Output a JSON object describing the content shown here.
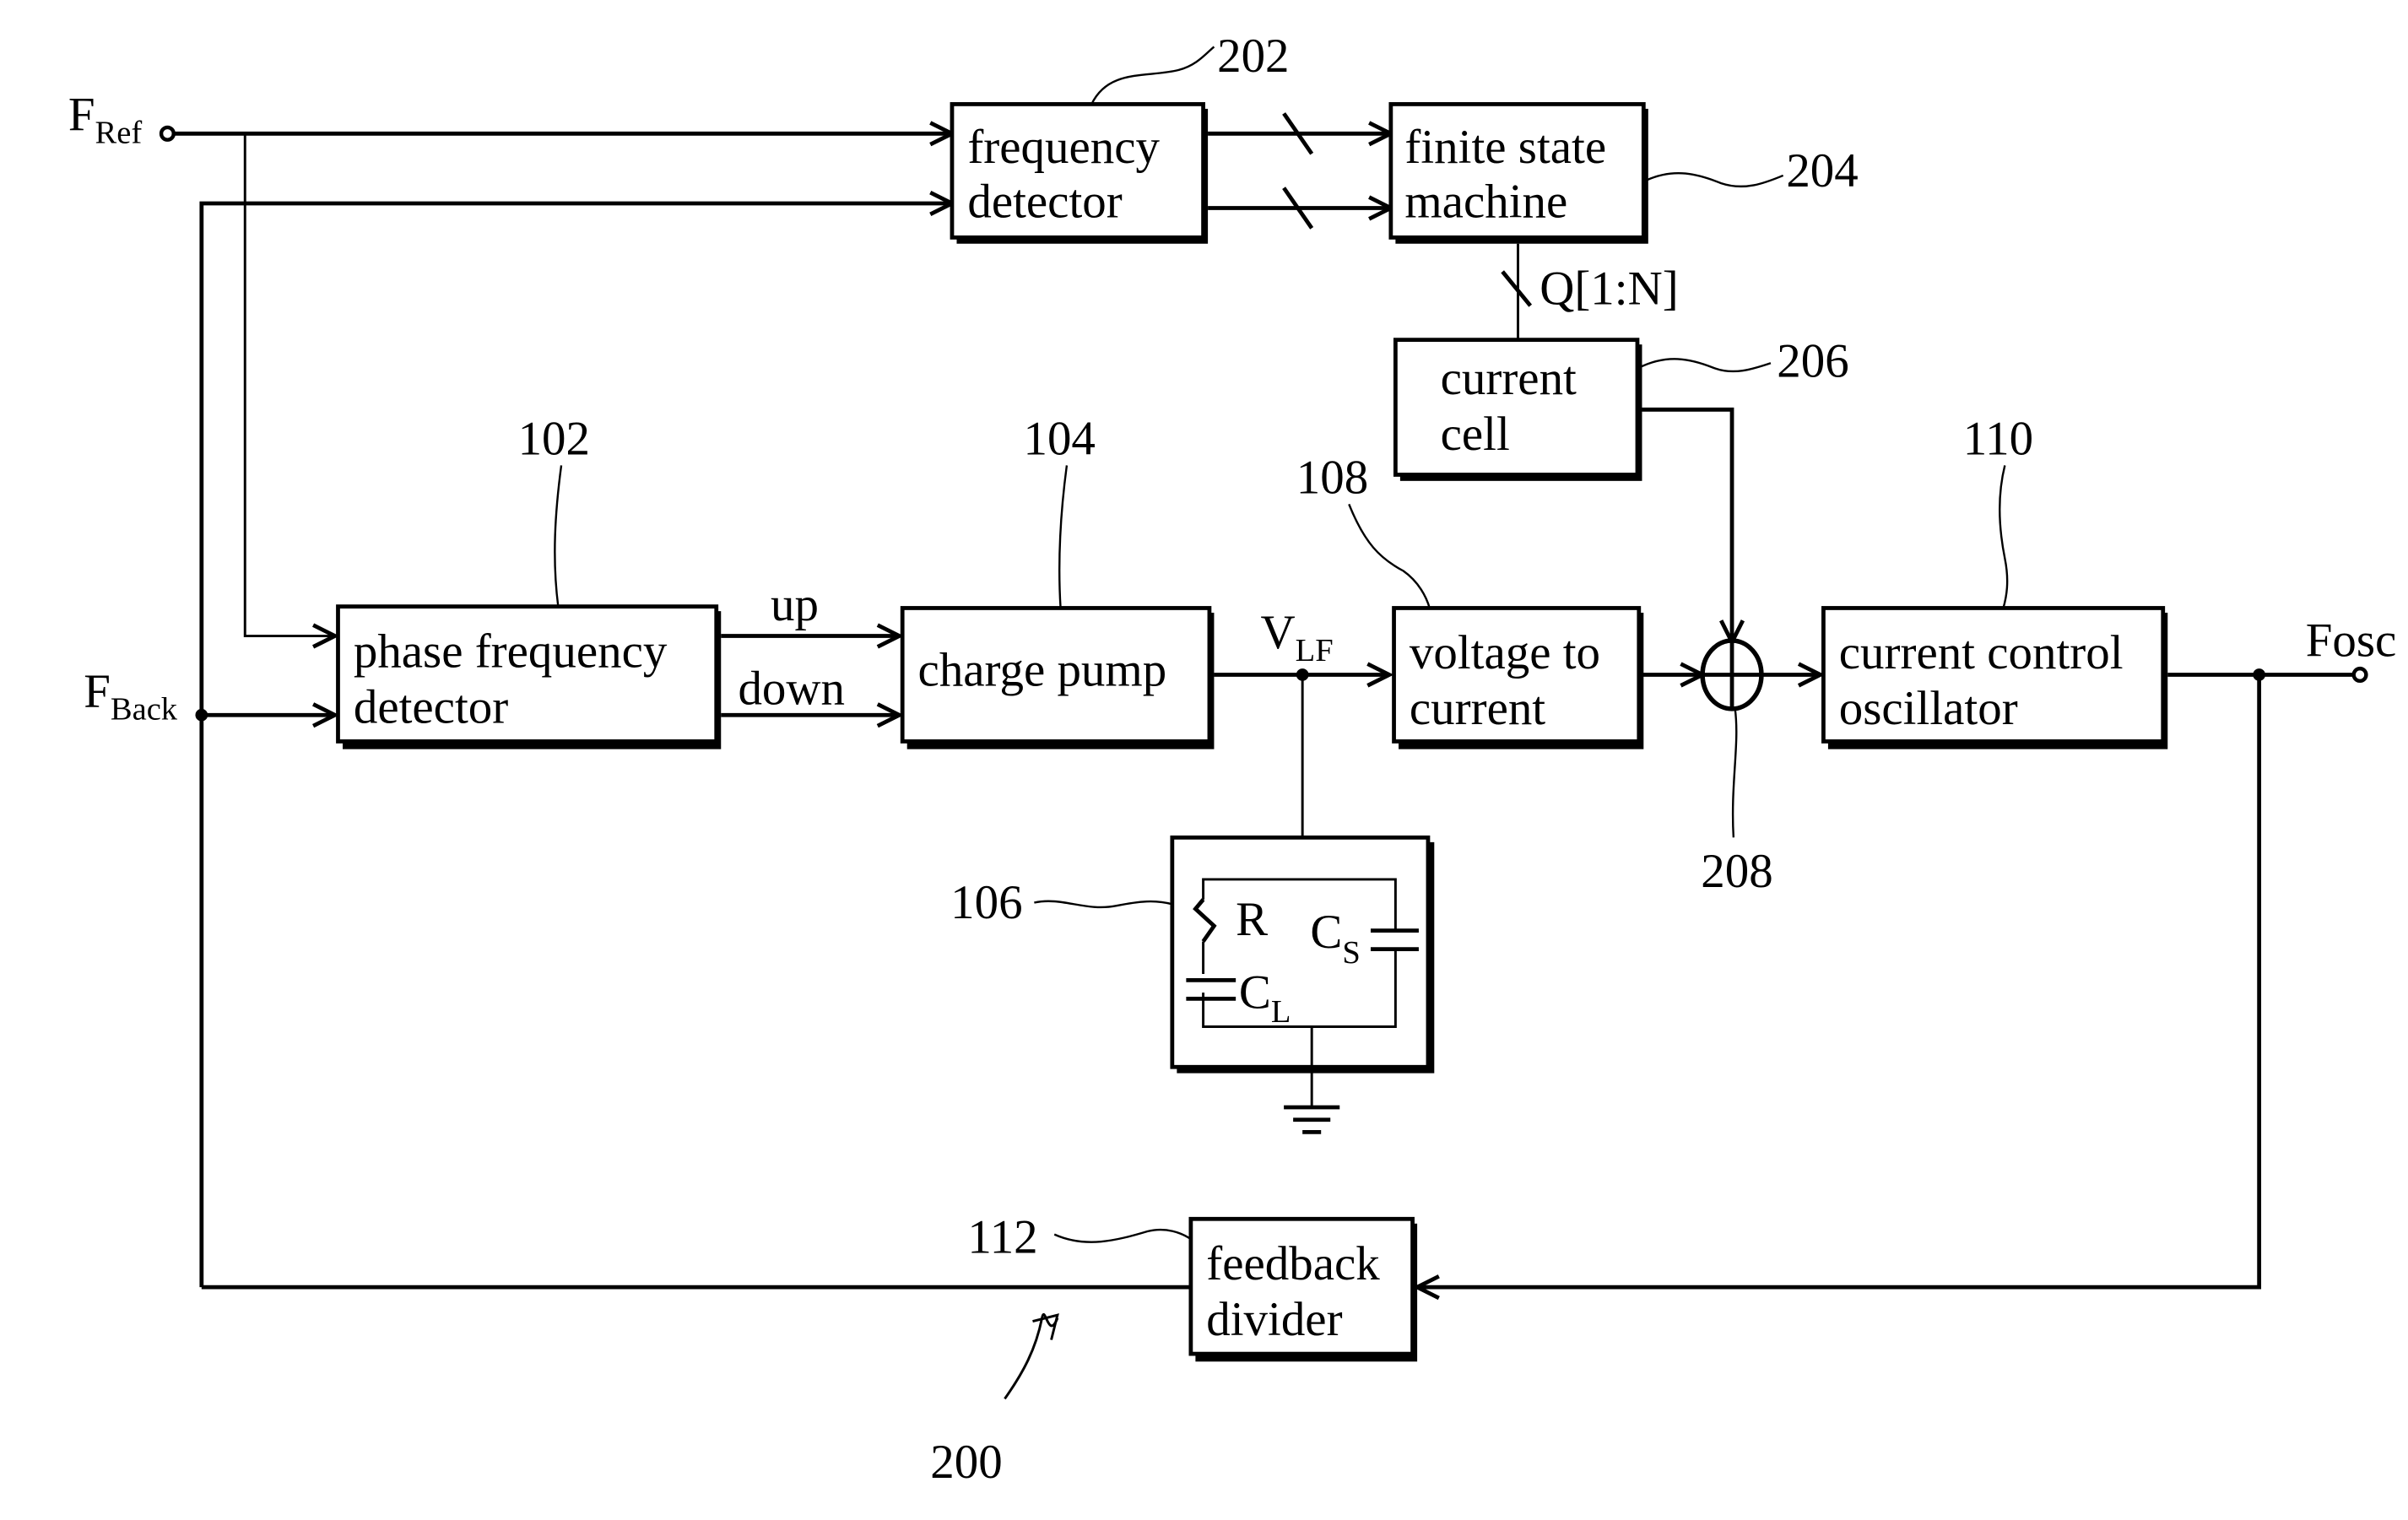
{
  "figure": {
    "ref_number": "200",
    "inputs": {
      "f_ref": {
        "main": "F",
        "sub": "Ref"
      },
      "f_back": {
        "main": "F",
        "sub": "Back"
      }
    },
    "output": {
      "label": "Fosc"
    },
    "blocks": [
      {
        "id": "pfd",
        "ref": "102",
        "lines": [
          "phase frequency",
          "detector"
        ]
      },
      {
        "id": "cp",
        "ref": "104",
        "lines": [
          "charge pump"
        ]
      },
      {
        "id": "lf",
        "ref": "106",
        "components": {
          "r": "R",
          "cl": {
            "main": "C",
            "sub": "L"
          },
          "cs": {
            "main": "C",
            "sub": "S"
          }
        }
      },
      {
        "id": "v2i",
        "ref": "108",
        "lines": [
          "voltage to",
          "current"
        ]
      },
      {
        "id": "cco",
        "ref": "110",
        "lines": [
          "current control",
          "oscillator"
        ]
      },
      {
        "id": "fbdiv",
        "ref": "112",
        "lines": [
          "feedback",
          "divider"
        ]
      },
      {
        "id": "fd",
        "ref": "202",
        "lines": [
          "frequency",
          "detector"
        ]
      },
      {
        "id": "fsm",
        "ref": "204",
        "lines": [
          "finite state",
          "machine"
        ]
      },
      {
        "id": "cc",
        "ref": "206",
        "lines": [
          "current",
          "cell"
        ]
      },
      {
        "id": "sum",
        "ref": "208"
      }
    ],
    "signals": {
      "up": "up",
      "down": "down",
      "vlf": {
        "main": "V",
        "sub": "LF"
      },
      "q_bus": "Q[1:N]"
    }
  }
}
